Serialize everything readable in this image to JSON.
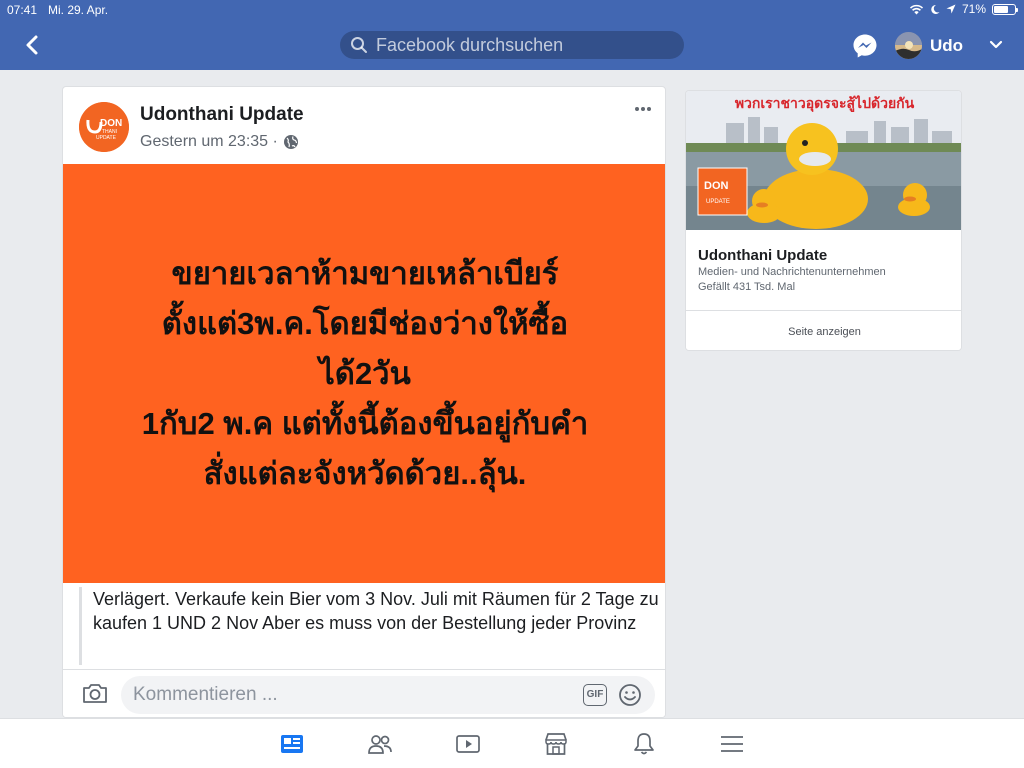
{
  "status_bar": {
    "time": "07:41",
    "date": "Mi. 29. Apr.",
    "battery": "71%",
    "battery_level": 0.71
  },
  "header": {
    "search_placeholder": "Facebook durchsuchen",
    "user_name": "Udo",
    "accent_color": "#4267b2"
  },
  "post": {
    "page_name": "Udonthani Update",
    "timestamp": "Gestern um 23:35 ·",
    "logo_text": [
      "DON",
      "THANI",
      "UPDATE"
    ],
    "banner_color": "#ff6220",
    "banner_lines": [
      "ขยายเวลาห้ามขายเหล้าเบียร์",
      "ตั้งแต่3พ.ค.โดยมีช่องว่างให้ซื้อ",
      "ได้2วัน",
      "1กับ2 พ.ค แต่ทั้งนี้ต้องขึ้นอยู่กับคำ",
      "สั่งแต่ละจังหวัดด้วย..ลุ้น."
    ],
    "translation": "Verlägert. Verkaufe kein Bier vom 3 Nov. Juli mit Räumen für 2 Tage zu kaufen 1 UND 2 Nov Aber es muss von der Bestellung jeder Provinz",
    "comment_placeholder": "Kommentieren ...",
    "gif_label": "GIF"
  },
  "page_card": {
    "cover_caption": "พวกเราชาวอุดรจะสู้ไปด้วยกัน",
    "logo_text": [
      "DON",
      "UPDATE"
    ],
    "name": "Udonthani Update",
    "category": "Medien- und Nachrichtenunternehmen",
    "likes": "Gefällt 431 Tsd. Mal",
    "button_label": "Seite anzeigen"
  },
  "bottom_nav": {
    "items": [
      "news-feed-icon",
      "friends-icon",
      "watch-icon",
      "marketplace-icon",
      "notifications-icon",
      "menu-icon"
    ],
    "active": "news-feed-icon",
    "active_color": "#1877f2"
  }
}
